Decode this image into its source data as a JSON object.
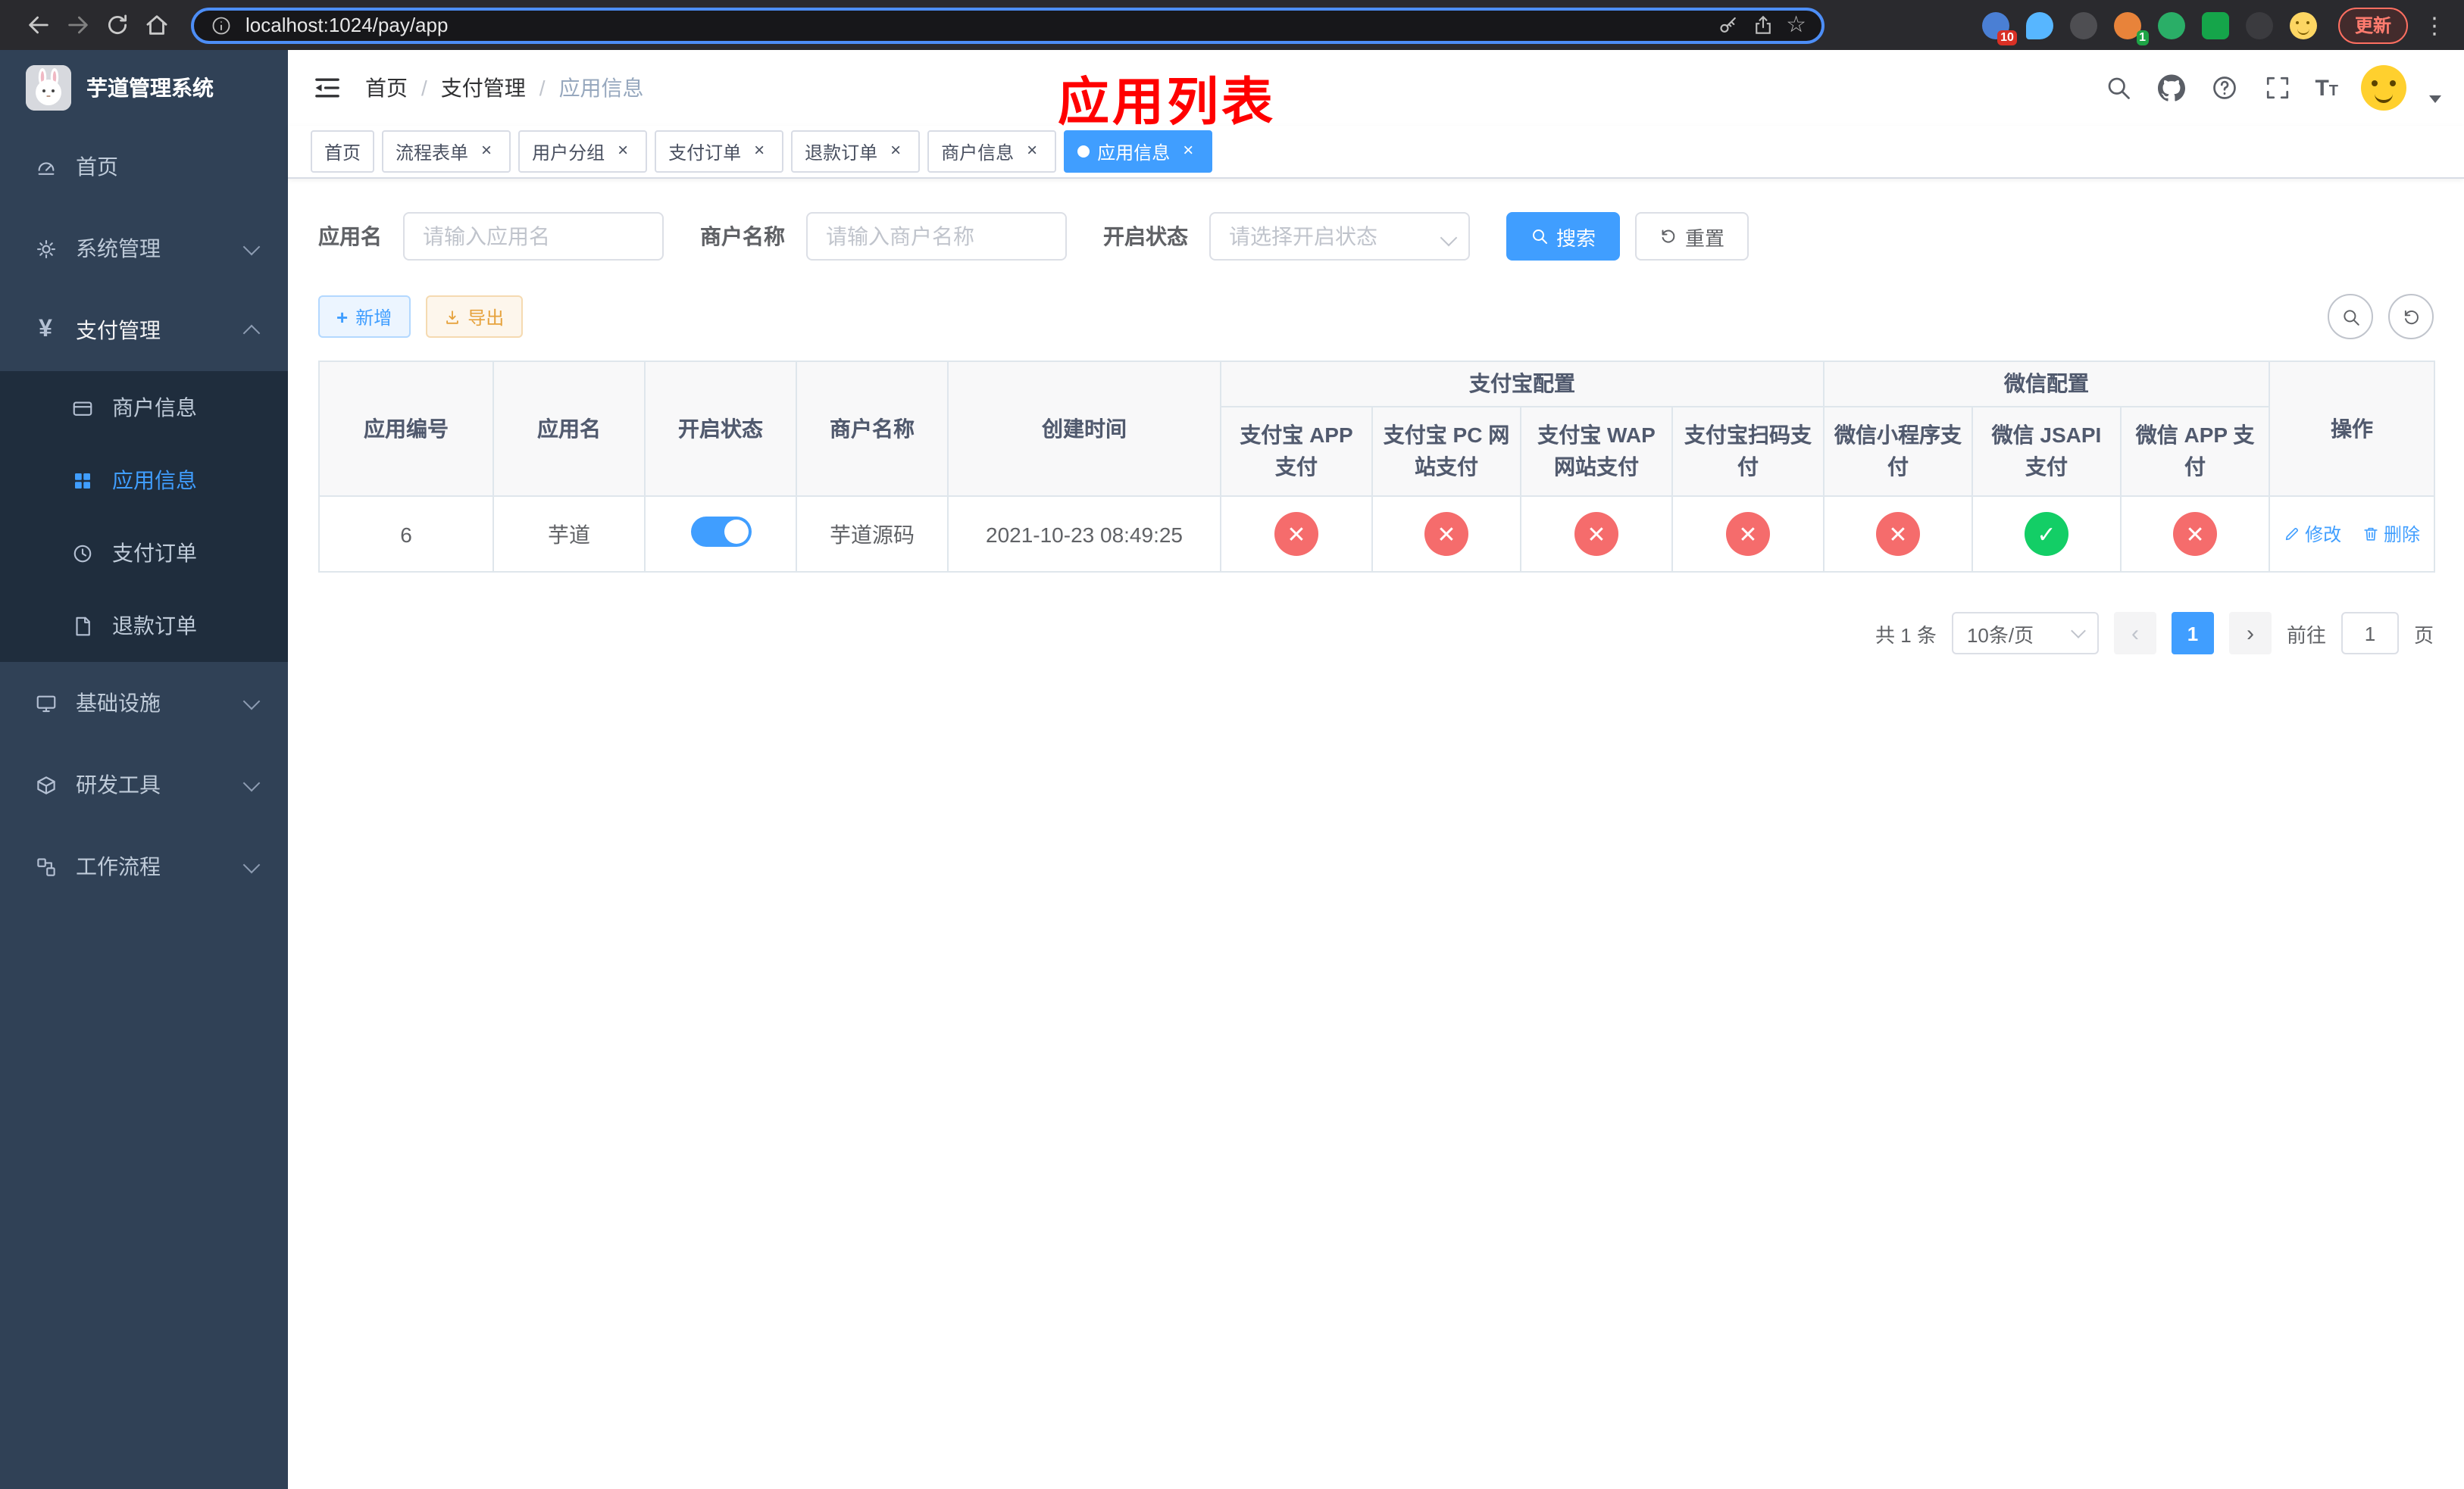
{
  "colors": {
    "accent": "#409eff",
    "success": "#13ce66",
    "danger": "#f56c6c",
    "warning": "#e6a23c",
    "annotation_red": "#ff0000",
    "sidebar_bg": "#304156",
    "submenu_bg": "#1f2d3d"
  },
  "icons": {
    "close": "×",
    "ok": "✓",
    "fail": "✕",
    "kebab": "⋮",
    "star": "☆",
    "prev": "‹",
    "next": "›"
  },
  "browser": {
    "url": "localhost:1024/pay/app",
    "update_label": "更新",
    "ext_badge_downloads": "10",
    "ext_badge_green": "1"
  },
  "sidebar": {
    "title": "芋道管理系统",
    "menu": [
      {
        "label": "首页"
      },
      {
        "label": "系统管理"
      },
      {
        "label": "支付管理",
        "children": [
          {
            "label": "商户信息"
          },
          {
            "label": "应用信息"
          },
          {
            "label": "支付订单"
          },
          {
            "label": "退款订单"
          }
        ]
      },
      {
        "label": "基础设施"
      },
      {
        "label": "研发工具"
      },
      {
        "label": "工作流程"
      }
    ]
  },
  "header": {
    "breadcrumbs": [
      "首页",
      "支付管理",
      "应用信息"
    ],
    "separator": "/",
    "annotation": "应用列表"
  },
  "tabs": [
    {
      "label": "首页"
    },
    {
      "label": "流程表单"
    },
    {
      "label": "用户分组"
    },
    {
      "label": "支付订单"
    },
    {
      "label": "退款订单"
    },
    {
      "label": "商户信息"
    },
    {
      "label": "应用信息"
    }
  ],
  "filters": {
    "app_name_label": "应用名",
    "app_name_placeholder": "请输入应用名",
    "merchant_label": "商户名称",
    "merchant_placeholder": "请输入商户名称",
    "status_label": "开启状态",
    "status_placeholder": "请选择开启状态",
    "search_label": "搜索",
    "reset_label": "重置"
  },
  "toolbar": {
    "add_label": "新增",
    "export_label": "导出"
  },
  "table": {
    "headers": {
      "app_id": "应用编号",
      "app_name": "应用名",
      "status": "开启状态",
      "merchant": "商户名称",
      "created": "创建时间",
      "alipay_group": "支付宝配置",
      "wechat_group": "微信配置",
      "alipay_app": "支付宝 APP 支付",
      "alipay_pc": "支付宝 PC 网站支付",
      "alipay_wap": "支付宝 WAP 网站支付",
      "alipay_scan": "支付宝扫码支付",
      "wechat_mini": "微信小程序支付",
      "wechat_jsapi": "微信 JSAPI 支付",
      "wechat_app": "微信 APP 支付",
      "actions": "操作"
    },
    "row": {
      "app_id": "6",
      "app_name": "芋道",
      "status_on": true,
      "merchant": "芋道源码",
      "created": "2021-10-23 08:49:25",
      "configs": [
        false,
        false,
        false,
        false,
        false,
        true,
        false
      ],
      "edit_label": "修改",
      "delete_label": "删除"
    }
  },
  "pagination": {
    "total": "共 1 条",
    "page_size": "10条/页",
    "page": "1",
    "goto_label": "前往",
    "goto_value": "1",
    "page_unit": "页"
  }
}
